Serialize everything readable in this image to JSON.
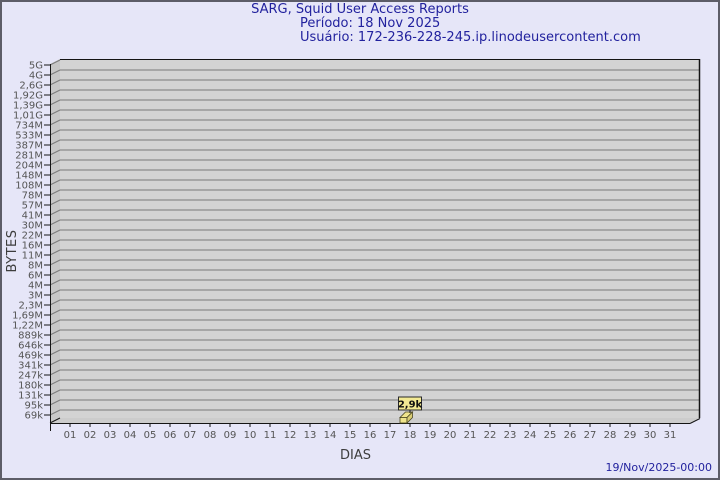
{
  "chart_data": {
    "type": "bar",
    "title": "SARG, Squid User Access Reports",
    "period_line": "Período: 18 Nov 2025",
    "user_line": "Usuário: 172-236-228-245.ip.linodeusercontent.com",
    "xlabel": "DIAS",
    "ylabel": "BYTES",
    "timestamp_label": "19/Nov/2025-00:00",
    "x_tick_labels": [
      "01",
      "02",
      "03",
      "04",
      "05",
      "06",
      "07",
      "08",
      "09",
      "10",
      "11",
      "12",
      "13",
      "14",
      "15",
      "16",
      "17",
      "18",
      "19",
      "20",
      "21",
      "22",
      "23",
      "24",
      "25",
      "26",
      "27",
      "28",
      "29",
      "30",
      "31"
    ],
    "y_tick_labels": [
      "5G",
      "4G",
      "2,6G",
      "1,92G",
      "1,39G",
      "1,01G",
      "734M",
      "533M",
      "387M",
      "281M",
      "204M",
      "148M",
      "108M",
      "78M",
      "57M",
      "41M",
      "30M",
      "22M",
      "16M",
      "11M",
      "8M",
      "6M",
      "4M",
      "3M",
      "2,3M",
      "1,69M",
      "1,22M",
      "889k",
      "646k",
      "469k",
      "341k",
      "247k",
      "180k",
      "131k",
      "95k",
      "69k"
    ],
    "bars": [
      {
        "day": "18",
        "value_label": "2,9k",
        "value_bytes": 2900
      }
    ],
    "legend": "none",
    "grid": "horizontal"
  },
  "colors": {
    "background": "#e6e6f8",
    "frame_border": "#5d5d68",
    "title_text": "#22229e",
    "plot_fill": "#d3d3d3",
    "wall_fill": "#c7c7c7",
    "floor_fill": "#cccccc",
    "grid": "#7a7a7a",
    "axis": "#141414",
    "tick_text": "#555555",
    "axis_label_text": "#3d3d3d",
    "bar_fill": "#efe48c",
    "bar_side": "#d9cd74",
    "bar_stroke": "#4a4621",
    "annot_fill": "#f2e993",
    "annot_border": "#2a2a2a",
    "annot_text": "#111111"
  }
}
